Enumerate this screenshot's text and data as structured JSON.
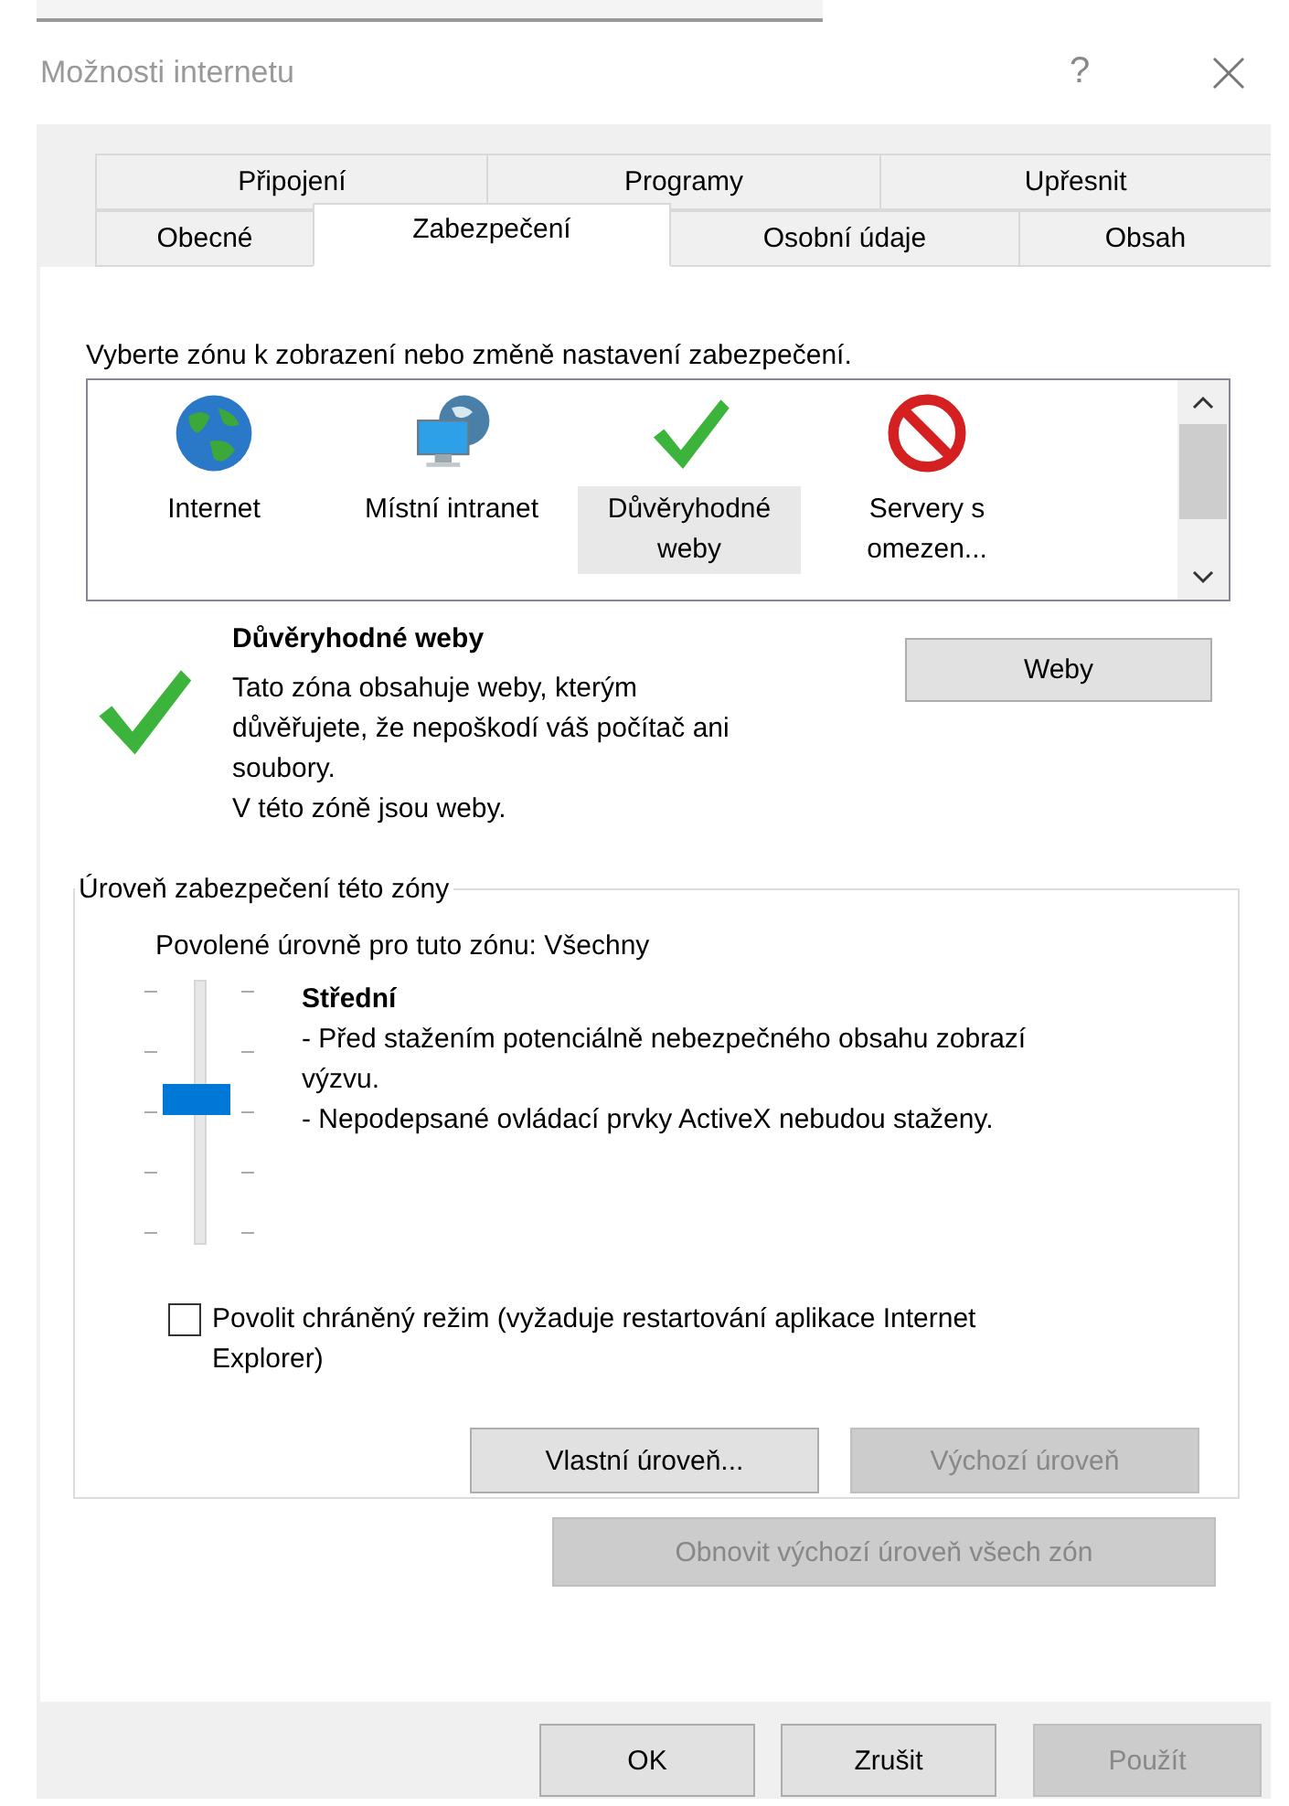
{
  "window": {
    "title": "Možnosti internetu",
    "help": "?"
  },
  "tabs": [
    [
      {
        "label": "Připojení",
        "selected": false
      },
      {
        "label": "Programy",
        "selected": false
      },
      {
        "label": "Upřesnit",
        "selected": false
      }
    ],
    [
      {
        "label": "Obecné",
        "selected": false
      },
      {
        "label": "Zabezpečení",
        "selected": true
      },
      {
        "label": "Osobní údaje",
        "selected": false
      },
      {
        "label": "Obsah",
        "selected": false
      }
    ]
  ],
  "zone_prompt": "Vyberte zónu k zobrazení nebo změně nastavení zabezpečení.",
  "zones": [
    {
      "kind": "globe",
      "label": "Internet",
      "selected": false
    },
    {
      "kind": "intranet",
      "label": "Místní intranet",
      "selected": false
    },
    {
      "kind": "trusted",
      "label": "Důvěryhodné weby",
      "selected": true
    },
    {
      "kind": "restricted",
      "label": "Servery s omezen...",
      "selected": false
    }
  ],
  "zone_details": {
    "kind": "trusted",
    "title": "Důvěryhodné weby",
    "description": "Tato zóna obsahuje weby, kterým důvěřujete, že nepoškodí váš počítač ani soubory.",
    "note": "V této zóně jsou weby.",
    "button": "Weby"
  },
  "security_level": {
    "legend": "Úroveň zabezpečení této zóny",
    "allowed": "Povolené úrovně pro tuto zónu: Všechny",
    "level": 0.5,
    "level_name": "Střední",
    "details": [
      "- Před stažením potenciálně nebezpečného obsahu zobrazí výzvu.",
      "- Nepodepsané ovládací prvky ActiveX nebudou staženy."
    ],
    "protected_mode": {
      "label": "Povolit chráněný režim (vyžaduje restartování aplikace Internet Explorer)",
      "checked": false
    },
    "buttons": [
      {
        "label": "Vlastní úroveň...",
        "disabled": false
      },
      {
        "label": "Výchozí úroveň",
        "disabled": true
      }
    ]
  },
  "reset_button": {
    "label": "Obnovit výchozí úroveň všech zón",
    "disabled": true
  },
  "dialog_buttons": [
    {
      "label": "OK",
      "disabled": false
    },
    {
      "label": "Zrušit",
      "disabled": false
    },
    {
      "label": "Použít",
      "disabled": true
    }
  ]
}
